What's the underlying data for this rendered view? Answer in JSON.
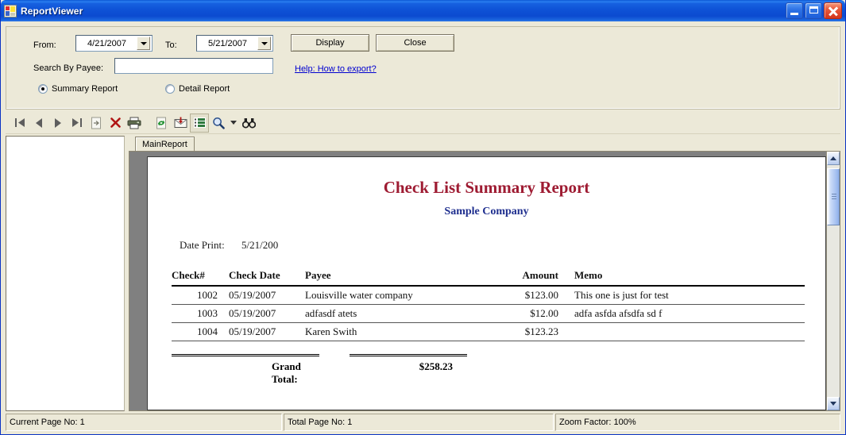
{
  "window": {
    "title": "ReportViewer",
    "icon": "report-app-icon",
    "buttons": {
      "minimize": "minimize-button",
      "maximize": "maximize-button",
      "close": "close-button"
    }
  },
  "filter_panel": {
    "from_label": "From:",
    "from_value": "4/21/2007",
    "to_label": "To:",
    "to_value": "5/21/2007",
    "search_label": "Search By Payee:",
    "search_value": "",
    "search_placeholder": "",
    "display_button": "Display",
    "close_button": "Close",
    "help_link": "Help: How to export?",
    "report_type": {
      "summary_label": "Summary Report",
      "detail_label": "Detail Report",
      "selected": "Summary Report"
    }
  },
  "toolbar": {
    "items": [
      {
        "name": "first-page-icon",
        "label": "First Page"
      },
      {
        "name": "previous-page-icon",
        "label": "Previous Page"
      },
      {
        "name": "next-page-icon",
        "label": "Next Page"
      },
      {
        "name": "last-page-icon",
        "label": "Last Page"
      },
      {
        "name": "go-to-page-icon",
        "label": "Go To Page"
      },
      {
        "name": "stop-icon",
        "label": "Stop Loading"
      },
      {
        "name": "print-icon",
        "label": "Print"
      },
      {
        "name": "refresh-icon",
        "label": "Refresh"
      },
      {
        "name": "export-icon",
        "label": "Export"
      },
      {
        "name": "toggle-group-tree-icon",
        "label": "Toggle Group Tree"
      },
      {
        "name": "zoom-icon",
        "label": "Zoom"
      },
      {
        "name": "zoom-dropdown-icon",
        "label": "Zoom Options"
      },
      {
        "name": "search-text-icon",
        "label": "Find Text"
      }
    ]
  },
  "tabs": {
    "items": [
      "MainReport"
    ],
    "active": "MainReport"
  },
  "report": {
    "title": "Check List Summary Report",
    "subtitle": "Sample Company",
    "date_print_label": "Date Print:",
    "date_print_value": "5/21/200",
    "columns": [
      "Check#",
      "Check Date",
      "Payee",
      "Amount",
      "Memo"
    ],
    "rows": [
      {
        "check": "1002",
        "date": "05/19/2007",
        "payee": "Louisville water company",
        "amount": "$123.00",
        "memo": "This one is just for test"
      },
      {
        "check": "1003",
        "date": "05/19/2007",
        "payee": "adfasdf atets",
        "amount": "$12.00",
        "memo": "adfa asfda afsdfa sd f"
      },
      {
        "check": "1004",
        "date": "05/19/2007",
        "payee": "Karen Swith",
        "amount": "$123.23",
        "memo": ""
      }
    ],
    "grand_total_label": "Grand Total:",
    "grand_total_value": "$258.23",
    "colors": {
      "title": "#9e1b32",
      "subtitle": "#1f2f8f"
    }
  },
  "statusbar": {
    "current_page": "Current Page No: 1",
    "total_page": "Total Page No: 1",
    "zoom_factor": "Zoom Factor: 100%"
  }
}
